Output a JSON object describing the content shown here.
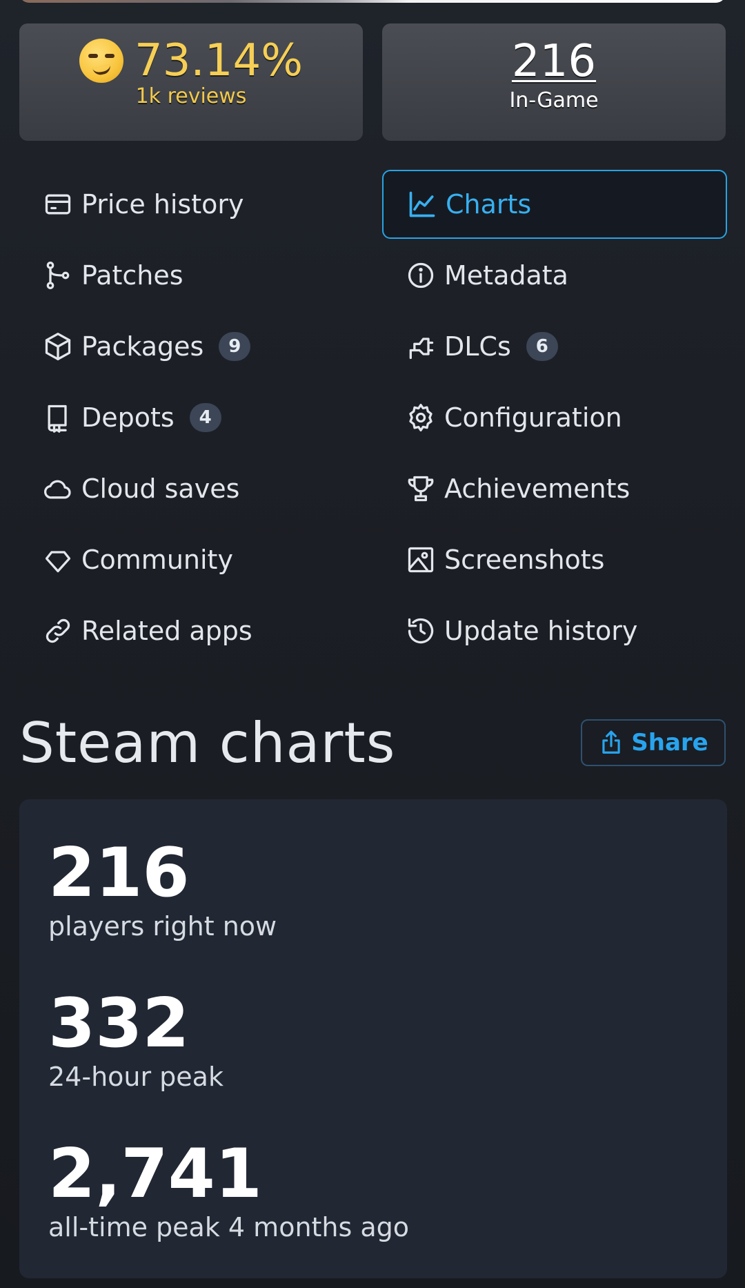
{
  "rating": {
    "emoji": "smirk-emoji",
    "percent": "73.14%",
    "reviews": "1k reviews"
  },
  "ingame": {
    "count": "216",
    "label": "In-Game"
  },
  "nav": {
    "price_history": "Price history",
    "charts": "Charts",
    "patches": "Patches",
    "metadata": "Metadata",
    "packages": "Packages",
    "packages_count": "9",
    "dlcs": "DLCs",
    "dlcs_count": "6",
    "depots": "Depots",
    "depots_count": "4",
    "configuration": "Configuration",
    "cloud_saves": "Cloud saves",
    "achievements": "Achievements",
    "community": "Community",
    "screenshots": "Screenshots",
    "related_apps": "Related apps",
    "update_history": "Update history"
  },
  "section": {
    "title": "Steam charts",
    "share_label": "Share"
  },
  "stats": [
    {
      "value": "216",
      "label": "players right now"
    },
    {
      "value": "332",
      "label": "24-hour peak"
    },
    {
      "value": "2,741",
      "label": "all-time peak 4 months ago"
    }
  ],
  "colors": {
    "accent": "#29a3e3",
    "rating": "#f6cf55",
    "badge_bg": "#3c4656",
    "card_bg": "#212733"
  }
}
